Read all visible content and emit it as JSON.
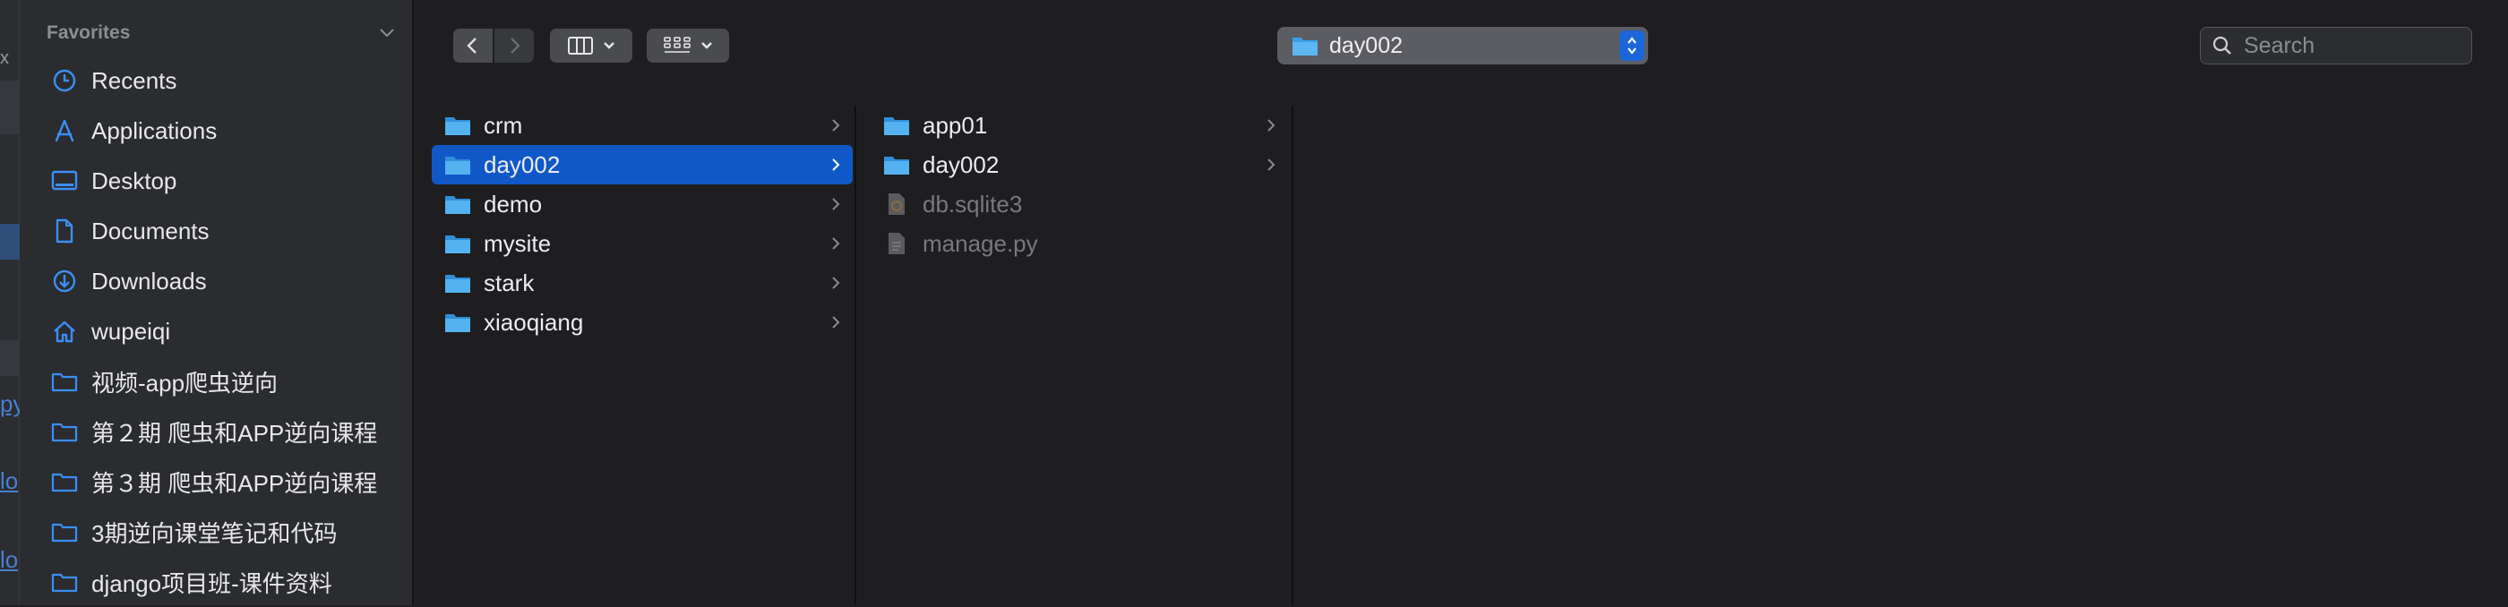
{
  "backdrop": {
    "marks": [
      "x",
      "py",
      "lo",
      "lo"
    ]
  },
  "sidebar": {
    "section_title": "Favorites",
    "items": [
      {
        "label": "Recents",
        "icon": "clock-icon"
      },
      {
        "label": "Applications",
        "icon": "applications-icon"
      },
      {
        "label": "Desktop",
        "icon": "desktop-icon"
      },
      {
        "label": "Documents",
        "icon": "document-icon"
      },
      {
        "label": "Downloads",
        "icon": "downloads-icon"
      },
      {
        "label": "wupeiqi",
        "icon": "home-icon"
      },
      {
        "label": "视频-app爬虫逆向",
        "icon": "folder-icon"
      },
      {
        "label": "第２期 爬虫和APP逆向课程",
        "icon": "folder-icon"
      },
      {
        "label": "第３期 爬虫和APP逆向课程",
        "icon": "folder-icon"
      },
      {
        "label": "3期逆向课堂笔记和代码",
        "icon": "folder-icon"
      },
      {
        "label": "django项目班-课件资料",
        "icon": "folder-icon"
      }
    ]
  },
  "toolbar": {
    "path_label": "day002",
    "search_placeholder": "Search"
  },
  "columns": [
    {
      "items": [
        {
          "label": "crm",
          "kind": "folder",
          "selected": false
        },
        {
          "label": "day002",
          "kind": "folder",
          "selected": true
        },
        {
          "label": "demo",
          "kind": "folder",
          "selected": false
        },
        {
          "label": "mysite",
          "kind": "folder",
          "selected": false
        },
        {
          "label": "stark",
          "kind": "folder",
          "selected": false
        },
        {
          "label": "xiaoqiang",
          "kind": "folder",
          "selected": false
        }
      ]
    },
    {
      "items": [
        {
          "label": "app01",
          "kind": "folder",
          "selected": false
        },
        {
          "label": "day002",
          "kind": "folder",
          "selected": false
        },
        {
          "label": "db.sqlite3",
          "kind": "file",
          "selected": false
        },
        {
          "label": "manage.py",
          "kind": "file",
          "selected": false
        }
      ]
    }
  ],
  "colors": {
    "accent": "#1158c7",
    "folder": "#3aa0ea",
    "sidebar_icon": "#3a8ff5"
  }
}
